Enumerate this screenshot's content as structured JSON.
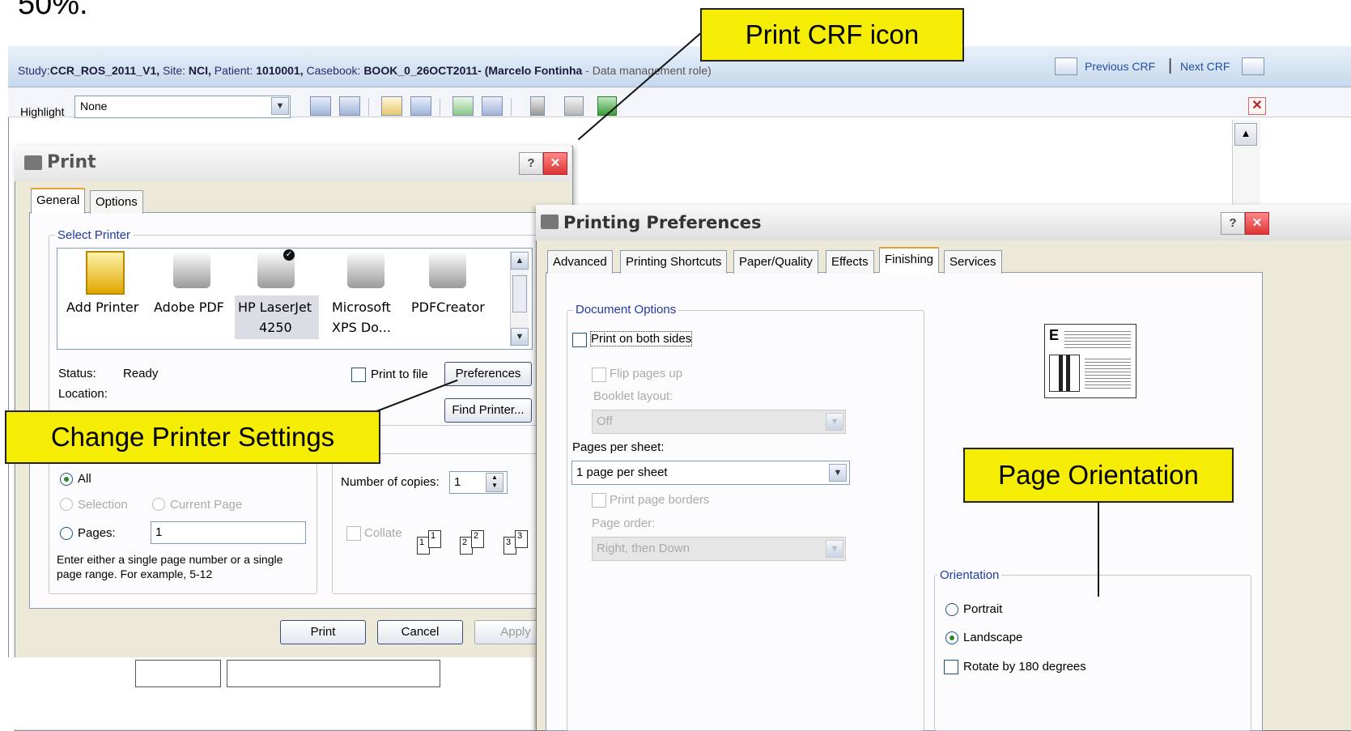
{
  "app": {
    "header": {
      "study_label": "Study:",
      "study": "CCR_ROS_2011_V1,",
      "site_label": " Site: ",
      "site": "NCI,",
      "patient_label": " Patient: ",
      "patient": "1010001,",
      "casebook_label": " Casebook: ",
      "casebook": "BOOK_0_26OCT2011- (Marcelo Fontinha",
      "role": " - Data management role)",
      "prev_crf": "Previous CRF",
      "separator": "|",
      "next_crf": "Next CRF"
    },
    "toolbar": {
      "highlight_label": "Highlight",
      "highlight_value": "None",
      "icons": [
        "add-crf-icon",
        "copy-crf-icon",
        "edit-icon",
        "form-icon",
        "verify-icon",
        "list-icon",
        "delete-icon",
        "print-crf-icon",
        "save-icon"
      ]
    }
  },
  "print_dialog": {
    "title": "Print",
    "tabs": [
      "General",
      "Options"
    ],
    "select_printer_label": "Select Printer",
    "printers": [
      {
        "name": "Add Printer",
        "line2": ""
      },
      {
        "name": "Adobe PDF",
        "line2": ""
      },
      {
        "name": "HP LaserJet",
        "line2": "4250"
      },
      {
        "name": "Microsoft",
        "line2": "XPS Do..."
      },
      {
        "name": "PDFCreator",
        "line2": ""
      }
    ],
    "status_label": "Status:",
    "status_value": "Ready",
    "location_label": "Location:",
    "print_to_file": "Print to file",
    "preferences_button": "Preferences",
    "find_printer_button": "Find Printer...",
    "range_all": "All",
    "range_selection": "Selection",
    "range_current": "Current Page",
    "range_pages": "Pages:",
    "pages_value": "1",
    "range_hint_1": "Enter either a single page number or a single",
    "range_hint_2": "page range.  For example, 5-12",
    "copies_label": "Number of copies:",
    "copies_value": "1",
    "collate": "Collate",
    "collate_pages": [
      "1",
      "1",
      "2",
      "2",
      "3",
      "3"
    ],
    "print_button": "Print",
    "cancel_button": "Cancel",
    "apply_button": "Apply"
  },
  "printing_preferences": {
    "title": "Printing Preferences",
    "tabs": [
      "Advanced",
      "Printing Shortcuts",
      "Paper/Quality",
      "Effects",
      "Finishing",
      "Services"
    ],
    "active_tab": "Finishing",
    "document_options_label": "Document Options",
    "print_both_sides": "Print on both sides",
    "flip_pages_up": "Flip pages up",
    "booklet_layout_label": "Booklet layout:",
    "booklet_layout_value": "Off",
    "pages_per_sheet_label": "Pages per sheet:",
    "pages_per_sheet_value": "1 page per sheet",
    "print_page_borders": "Print page borders",
    "page_order_label": "Page order:",
    "page_order_value": "Right, then Down",
    "orientation_label": "Orientation",
    "portrait": "Portrait",
    "landscape": "Landscape",
    "rotate_180": "Rotate by 180 degrees"
  },
  "callouts": {
    "print_crf_icon": "Print CRF icon",
    "change_printer_settings": "Change Printer Settings",
    "page_orientation": "Page Orientation"
  },
  "colors": {
    "callout_fill": "#f5ee04",
    "link_blue": "#1f4ea8",
    "group_title_blue": "#1f3aa8"
  }
}
